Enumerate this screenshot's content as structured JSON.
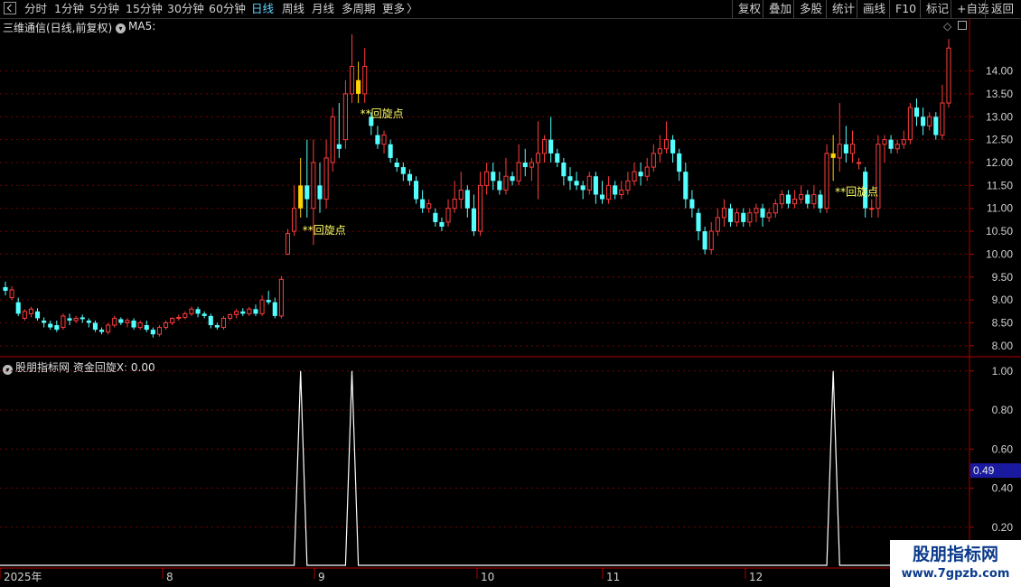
{
  "toolbar": {
    "periods": [
      "分时",
      "1分钟",
      "5分钟",
      "15分钟",
      "30分钟",
      "60分钟",
      "日线",
      "周线",
      "月线",
      "多周期",
      "更多"
    ],
    "active_period": "日线",
    "more_arrow": "〉",
    "right_buttons": [
      "复权",
      "叠加",
      "多股",
      "统计",
      "画线",
      "F10",
      "标记",
      "+自选",
      "返回"
    ]
  },
  "main_chart": {
    "title": "三维通信(日线,前复权)",
    "indicator": "MA5:",
    "price_ticks": [
      "14.00",
      "13.50",
      "13.00",
      "12.50",
      "12.00",
      "11.50",
      "11.00",
      "10.50",
      "10.00",
      "9.50",
      "9.00",
      "8.50",
      "8.00"
    ],
    "annotations": [
      "**回旋点",
      "**回旋点",
      "**回旋点"
    ],
    "colors": {
      "up": "#ff3c3c",
      "down": "#54ffff",
      "signal": "#ffd400",
      "grid": "#7a0000",
      "text": "#ffff66"
    }
  },
  "sub_chart": {
    "title": "股朋指标网 资金回旋X: 0.00",
    "ticks": [
      "1.00",
      "0.80",
      "0.60",
      "0.40",
      "0.20"
    ],
    "cursor_value": "0.49"
  },
  "date_axis": {
    "labels": [
      "2025年",
      "8",
      "9",
      "10",
      "11",
      "12"
    ]
  },
  "chart_data": {
    "type": "candlestick",
    "title": "三维通信(日线,前复权)",
    "ylim": [
      7.8,
      14.8
    ],
    "candles": [
      [
        9.28,
        9.2,
        9.4,
        9.1
      ],
      [
        9.05,
        9.22,
        9.3,
        9.0
      ],
      [
        8.95,
        8.7,
        9.05,
        8.65
      ],
      [
        8.6,
        8.75,
        8.8,
        8.55
      ],
      [
        8.7,
        8.8,
        8.85,
        8.62
      ],
      [
        8.75,
        8.6,
        8.82,
        8.55
      ],
      [
        8.55,
        8.5,
        8.62,
        8.4
      ],
      [
        8.48,
        8.4,
        8.55,
        8.35
      ],
      [
        8.45,
        8.35,
        8.55,
        8.3
      ],
      [
        8.4,
        8.65,
        8.7,
        8.35
      ],
      [
        8.6,
        8.55,
        8.7,
        8.45
      ],
      [
        8.55,
        8.6,
        8.65,
        8.5
      ],
      [
        8.62,
        8.58,
        8.68,
        8.5
      ],
      [
        8.55,
        8.5,
        8.6,
        8.4
      ],
      [
        8.5,
        8.35,
        8.55,
        8.3
      ],
      [
        8.35,
        8.3,
        8.4,
        8.25
      ],
      [
        8.3,
        8.45,
        8.5,
        8.25
      ],
      [
        8.45,
        8.6,
        8.65,
        8.4
      ],
      [
        8.58,
        8.5,
        8.62,
        8.45
      ],
      [
        8.5,
        8.55,
        8.6,
        8.4
      ],
      [
        8.55,
        8.4,
        8.6,
        8.35
      ],
      [
        8.4,
        8.5,
        8.55,
        8.35
      ],
      [
        8.45,
        8.35,
        8.55,
        8.3
      ],
      [
        8.35,
        8.25,
        8.4,
        8.18
      ],
      [
        8.25,
        8.4,
        8.45,
        8.2
      ],
      [
        8.4,
        8.5,
        8.55,
        8.35
      ],
      [
        8.5,
        8.6,
        8.62,
        8.45
      ],
      [
        8.6,
        8.62,
        8.68,
        8.55
      ],
      [
        8.62,
        8.7,
        8.75,
        8.58
      ],
      [
        8.7,
        8.8,
        8.85,
        8.65
      ],
      [
        8.8,
        8.7,
        8.85,
        8.62
      ],
      [
        8.7,
        8.65,
        8.75,
        8.6
      ],
      [
        8.65,
        8.45,
        8.7,
        8.38
      ],
      [
        8.45,
        8.4,
        8.5,
        8.35
      ],
      [
        8.4,
        8.6,
        8.65,
        8.35
      ],
      [
        8.6,
        8.68,
        8.7,
        8.55
      ],
      [
        8.68,
        8.75,
        8.8,
        8.6
      ],
      [
        8.75,
        8.7,
        8.82,
        8.65
      ],
      [
        8.7,
        8.8,
        8.85,
        8.65
      ],
      [
        8.8,
        8.7,
        8.9,
        8.65
      ],
      [
        8.7,
        9.0,
        9.1,
        8.65
      ],
      [
        9.0,
        8.95,
        9.2,
        8.9
      ],
      [
        8.95,
        8.65,
        9.05,
        8.6
      ],
      [
        8.65,
        9.45,
        9.52,
        8.6
      ],
      [
        10.0,
        10.45,
        10.55,
        10.0
      ],
      [
        10.5,
        11.0,
        11.5,
        10.4
      ],
      [
        11.0,
        11.5,
        12.1,
        10.8
      ],
      [
        11.5,
        11.2,
        12.5,
        10.8
      ],
      [
        11.0,
        12.0,
        12.5,
        10.2
      ],
      [
        11.5,
        11.2,
        12.0,
        10.9
      ],
      [
        11.2,
        12.1,
        12.5,
        11.0
      ],
      [
        12.0,
        13.0,
        13.2,
        11.8
      ],
      [
        12.4,
        12.3,
        13.3,
        12.1
      ],
      [
        12.5,
        13.5,
        13.8,
        12.3
      ],
      [
        13.5,
        14.1,
        14.8,
        13.3
      ],
      [
        13.8,
        13.5,
        14.2,
        13.3
      ],
      [
        13.5,
        14.1,
        14.5,
        13.3
      ],
      [
        13.0,
        12.8,
        13.1,
        12.6
      ],
      [
        12.6,
        12.4,
        12.8,
        12.3
      ],
      [
        12.4,
        12.6,
        12.7,
        12.2
      ],
      [
        12.4,
        12.1,
        12.5,
        12.0
      ],
      [
        12.0,
        11.9,
        12.1,
        11.8
      ],
      [
        11.9,
        11.75,
        12.0,
        11.6
      ],
      [
        11.75,
        11.6,
        11.85,
        11.5
      ],
      [
        11.6,
        11.2,
        11.7,
        11.1
      ],
      [
        11.2,
        11.0,
        11.4,
        10.9
      ],
      [
        11.0,
        11.1,
        11.2,
        10.9
      ],
      [
        10.9,
        10.7,
        11.0,
        10.6
      ],
      [
        10.7,
        10.6,
        10.8,
        10.5
      ],
      [
        10.7,
        11.0,
        11.2,
        10.6
      ],
      [
        11.0,
        11.2,
        11.6,
        10.9
      ],
      [
        11.2,
        11.4,
        11.8,
        11.0
      ],
      [
        11.4,
        11.0,
        11.5,
        10.8
      ],
      [
        11.0,
        10.5,
        11.3,
        10.4
      ],
      [
        10.5,
        11.5,
        11.8,
        10.4
      ],
      [
        11.5,
        11.8,
        12.0,
        11.3
      ],
      [
        11.8,
        11.6,
        12.0,
        11.4
      ],
      [
        11.6,
        11.4,
        11.8,
        11.3
      ],
      [
        11.4,
        11.7,
        12.1,
        11.3
      ],
      [
        11.7,
        11.6,
        11.8,
        11.5
      ],
      [
        11.6,
        12.0,
        12.4,
        11.5
      ],
      [
        12.0,
        11.9,
        12.3,
        11.7
      ],
      [
        11.9,
        12.0,
        12.1,
        11.6
      ],
      [
        12.0,
        12.2,
        12.9,
        11.2
      ],
      [
        12.2,
        12.5,
        12.6,
        12.0
      ],
      [
        12.5,
        12.2,
        13.0,
        12.0
      ],
      [
        12.2,
        12.0,
        12.3,
        11.9
      ],
      [
        12.0,
        11.7,
        12.1,
        11.5
      ],
      [
        11.7,
        11.6,
        11.9,
        11.4
      ],
      [
        11.6,
        11.5,
        11.8,
        11.4
      ],
      [
        11.5,
        11.4,
        11.6,
        11.2
      ],
      [
        11.4,
        11.7,
        11.8,
        11.3
      ],
      [
        11.7,
        11.3,
        11.8,
        11.1
      ],
      [
        11.3,
        11.2,
        11.6,
        11.1
      ],
      [
        11.2,
        11.5,
        11.7,
        11.1
      ],
      [
        11.5,
        11.3,
        11.6,
        11.2
      ],
      [
        11.3,
        11.4,
        11.6,
        11.2
      ],
      [
        11.4,
        11.6,
        11.8,
        11.3
      ],
      [
        11.6,
        11.8,
        12.0,
        11.5
      ],
      [
        11.8,
        11.7,
        12.0,
        11.5
      ],
      [
        11.7,
        11.9,
        12.1,
        11.6
      ],
      [
        11.9,
        12.2,
        12.4,
        11.8
      ],
      [
        12.2,
        12.3,
        12.6,
        12.0
      ],
      [
        12.3,
        12.5,
        12.9,
        12.2
      ],
      [
        12.5,
        12.2,
        12.6,
        12.0
      ],
      [
        12.2,
        11.8,
        12.3,
        11.6
      ],
      [
        11.8,
        11.2,
        12.0,
        11.0
      ],
      [
        11.2,
        11.0,
        11.4,
        10.8
      ],
      [
        10.9,
        10.5,
        11.0,
        10.3
      ],
      [
        10.5,
        10.1,
        10.6,
        10.0
      ],
      [
        10.1,
        10.5,
        10.7,
        10.0
      ],
      [
        10.5,
        10.8,
        11.0,
        10.4
      ],
      [
        10.8,
        11.0,
        11.2,
        10.6
      ],
      [
        11.0,
        10.7,
        11.1,
        10.6
      ],
      [
        10.7,
        10.9,
        11.0,
        10.6
      ],
      [
        10.9,
        10.7,
        11.0,
        10.6
      ],
      [
        10.7,
        10.9,
        11.0,
        10.6
      ],
      [
        10.9,
        11.0,
        11.1,
        10.7
      ],
      [
        11.0,
        10.8,
        11.1,
        10.6
      ],
      [
        10.8,
        10.9,
        11.0,
        10.7
      ],
      [
        10.9,
        11.1,
        11.2,
        10.8
      ],
      [
        11.1,
        11.3,
        11.4,
        11.0
      ],
      [
        11.3,
        11.1,
        11.4,
        11.0
      ],
      [
        11.1,
        11.2,
        11.4,
        11.0
      ],
      [
        11.2,
        11.3,
        11.5,
        11.1
      ],
      [
        11.3,
        11.1,
        11.4,
        11.0
      ],
      [
        11.1,
        11.3,
        11.5,
        11.0
      ],
      [
        11.3,
        11.0,
        11.4,
        10.9
      ],
      [
        11.0,
        12.2,
        12.4,
        10.9
      ],
      [
        12.2,
        12.1,
        12.6,
        11.6
      ],
      [
        12.1,
        12.4,
        13.3,
        11.8
      ],
      [
        12.4,
        12.2,
        12.8,
        12.0
      ],
      [
        12.2,
        12.4,
        12.7,
        12.0
      ],
      [
        12.0,
        12.0,
        12.1,
        11.85
      ],
      [
        11.8,
        11.0,
        11.9,
        10.8
      ],
      [
        11.0,
        11.0,
        11.2,
        10.8
      ],
      [
        11.0,
        12.4,
        12.6,
        10.8
      ],
      [
        12.4,
        12.5,
        12.6,
        12.0
      ],
      [
        12.5,
        12.3,
        12.6,
        12.2
      ],
      [
        12.3,
        12.4,
        12.5,
        12.2
      ],
      [
        12.4,
        12.5,
        12.7,
        12.3
      ],
      [
        12.5,
        13.2,
        13.3,
        12.4
      ],
      [
        13.2,
        13.0,
        13.4,
        12.8
      ],
      [
        13.0,
        12.8,
        13.2,
        12.6
      ],
      [
        12.8,
        13.0,
        13.1,
        12.7
      ],
      [
        13.0,
        12.6,
        13.1,
        12.5
      ],
      [
        12.6,
        13.3,
        13.7,
        12.5
      ],
      [
        13.3,
        14.5,
        14.7,
        13.2
      ]
    ],
    "signal_candles": [
      46,
      55,
      129
    ],
    "signal_labels": [
      "**回旋点",
      "**回旋点",
      "**回旋点"
    ],
    "sub_indicator": {
      "name": "资金回旋X",
      "ylim": [
        0,
        1.05
      ],
      "peaks": [
        46,
        54,
        129
      ],
      "peak_value": 1.0
    }
  }
}
